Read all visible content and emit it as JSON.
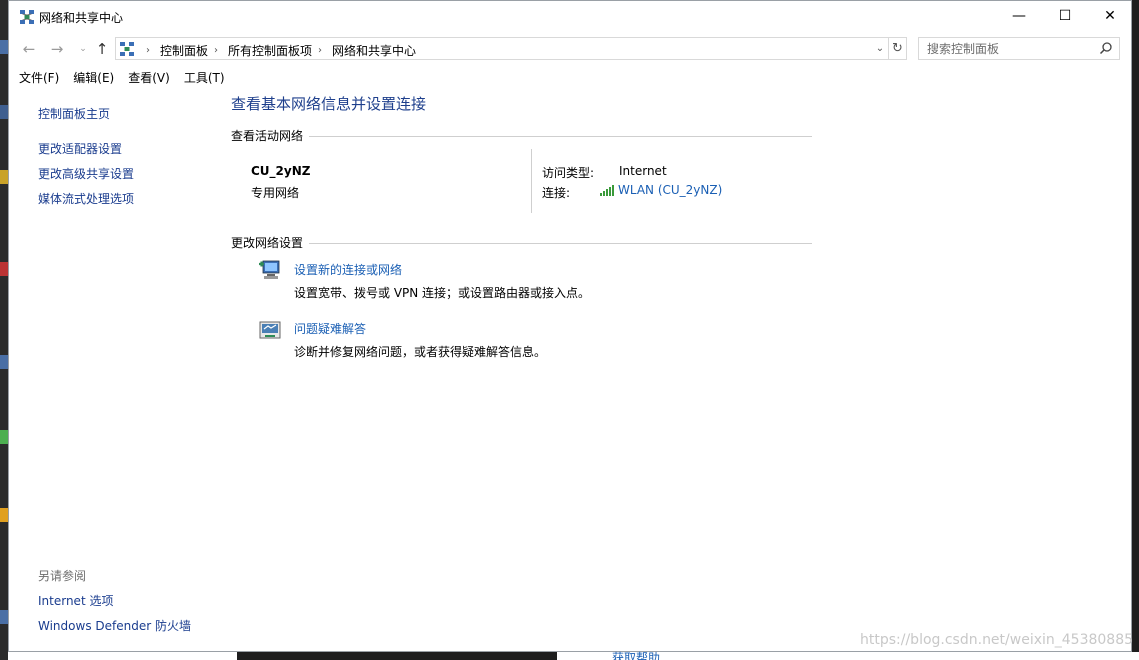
{
  "window": {
    "title": "网络和共享中心",
    "minimize_glyph": "—",
    "maximize_glyph": "☐",
    "close_glyph": "✕"
  },
  "address": {
    "breadcrumbs": [
      "控制面板",
      "所有控制面板项",
      "网络和共享中心"
    ],
    "search_placeholder": "搜索控制面板"
  },
  "nav_glyphs": {
    "back": "←",
    "forward": "→",
    "recent": "⌄",
    "up": "↑",
    "dropdown": "⌄",
    "refresh": "↻"
  },
  "menu": [
    "文件(F)",
    "编辑(E)",
    "查看(V)",
    "工具(T)"
  ],
  "sidebar": {
    "links": [
      "控制面板主页",
      "更改适配器设置",
      "更改高级共享设置",
      "媒体流式处理选项"
    ],
    "see_also_label": "另请参阅",
    "see_also_links": [
      "Internet 选项",
      "Windows Defender 防火墙"
    ]
  },
  "main": {
    "title": "查看基本网络信息并设置连接",
    "active_header": "查看活动网络",
    "network_name": "CU_2yNZ",
    "network_type": "专用网络",
    "access_label": "访问类型:",
    "access_value": "Internet",
    "connection_label": "连接:",
    "connection_value": "WLAN (CU_2yNZ)",
    "change_header": "更改网络设置",
    "tasks": [
      {
        "link": "设置新的连接或网络",
        "desc": "设置宽带、拨号或 VPN 连接；或设置路由器或接入点。"
      },
      {
        "link": "问题疑难解答",
        "desc": "诊断并修复网络问题，或者获得疑难解答信息。"
      }
    ]
  },
  "background": {
    "help_text": "获取帮助",
    "watermark": "https://blog.csdn.net/weixin_45380885"
  },
  "colors": {
    "link": "#1a5fb4",
    "title": "#1e3f8c",
    "signal": "#3a9a3a"
  }
}
